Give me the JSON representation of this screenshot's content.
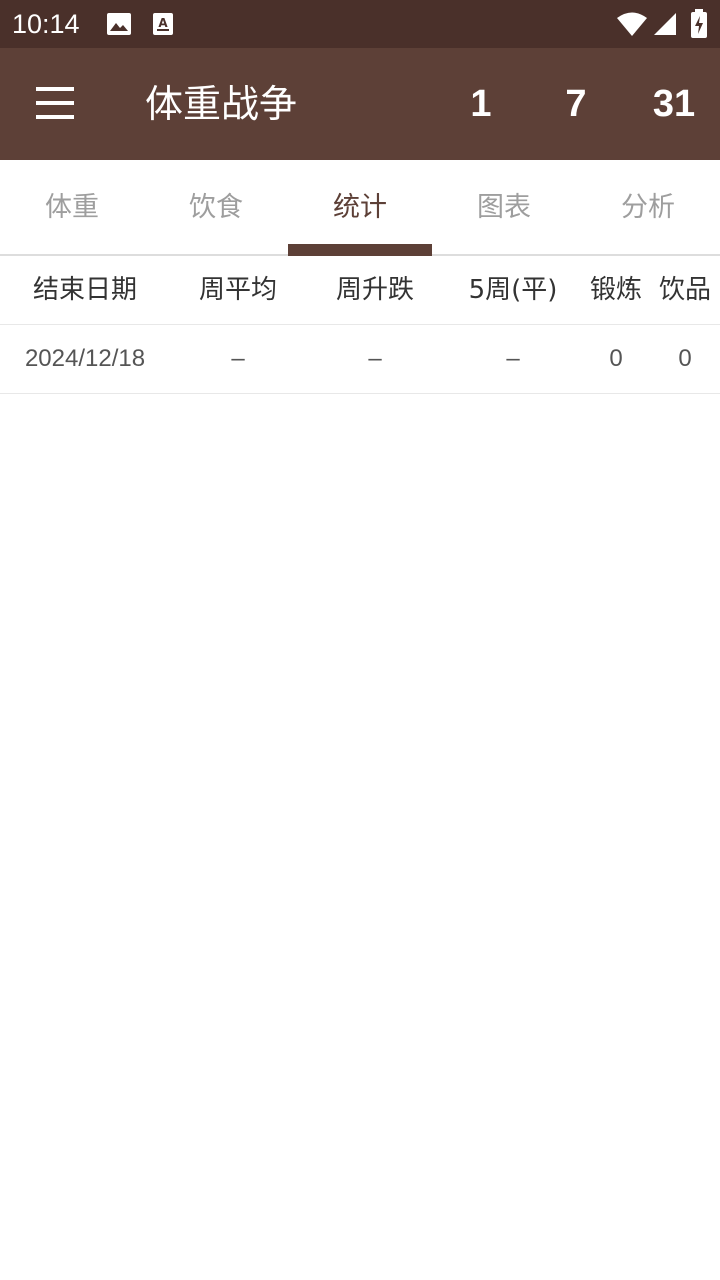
{
  "status_bar": {
    "time": "10:14",
    "icons": [
      "image-icon",
      "text-a-icon",
      "wifi-icon",
      "signal-icon",
      "battery-charging-icon"
    ]
  },
  "app_bar": {
    "menu_icon": "menu-icon",
    "title": "体重战争",
    "counters": [
      "1",
      "7",
      "31"
    ]
  },
  "tabs": [
    {
      "label": "体重",
      "active": false
    },
    {
      "label": "饮食",
      "active": false
    },
    {
      "label": "统计",
      "active": true
    },
    {
      "label": "图表",
      "active": false
    },
    {
      "label": "分析",
      "active": false
    }
  ],
  "table": {
    "headers": [
      "结束日期",
      "周平均",
      "周升跌",
      "5周(平)",
      "锻炼",
      "饮品"
    ],
    "rows": [
      [
        "2024/12/18",
        "–",
        "–",
        "–",
        "0",
        "0"
      ]
    ]
  },
  "colors": {
    "status_bar": "#4a302a",
    "app_bar": "#5d4037",
    "accent": "#5d4037",
    "tab_inactive": "#9e9e9e"
  }
}
